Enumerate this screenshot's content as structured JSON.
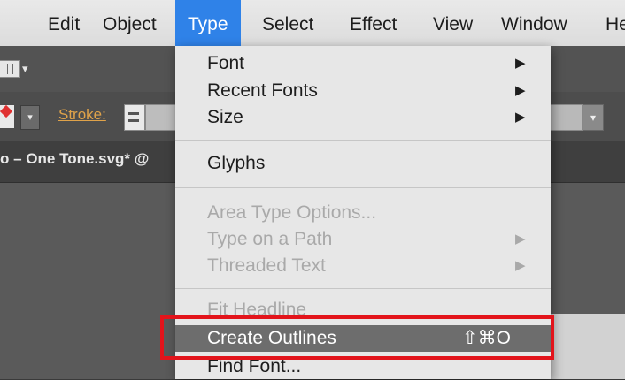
{
  "menubar": {
    "items": [
      "Edit",
      "Object",
      "Type",
      "Select",
      "Effect",
      "View",
      "Window",
      "He"
    ],
    "active_index": 2
  },
  "toolbar": {
    "stroke_label": "Stroke:"
  },
  "document_tab": {
    "title": "o – One Tone.svg* @"
  },
  "type_menu": {
    "font": "Font",
    "recent_fonts": "Recent Fonts",
    "size": "Size",
    "glyphs": "Glyphs",
    "area_type_options": "Area Type Options...",
    "type_on_a_path": "Type on a Path",
    "threaded_text": "Threaded Text",
    "fit_headline": "Fit Headline",
    "create_outlines": "Create Outlines",
    "create_outlines_shortcut": "⇧⌘O",
    "find_font": "Find Font..."
  },
  "colors": {
    "menu_highlight": "#2f82e8",
    "row_highlight": "#6d6d6d",
    "callout": "#e3141b",
    "stroke_label": "#e0a34a"
  },
  "icons": {
    "submenu": "triangle-right-icon",
    "dropdown": "chevron-down-icon"
  }
}
